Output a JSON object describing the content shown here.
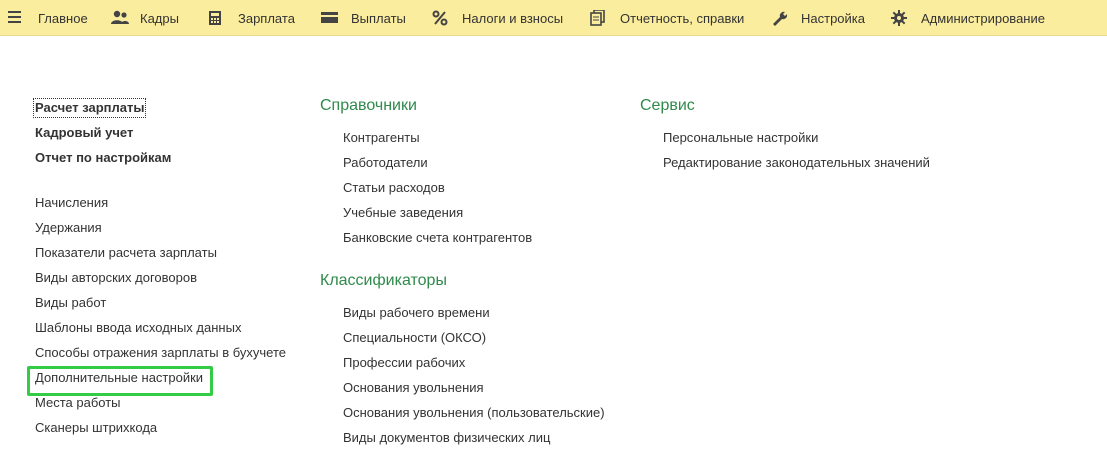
{
  "menu": {
    "items": [
      {
        "icon": "hamburger-icon",
        "label": "Главное"
      },
      {
        "icon": "people-icon",
        "label": "Кадры"
      },
      {
        "icon": "calculator-icon",
        "label": "Зарплата"
      },
      {
        "icon": "payments-card-icon",
        "label": "Выплаты"
      },
      {
        "icon": "percent-icon",
        "label": "Налоги и взносы"
      },
      {
        "icon": "reports-icon",
        "label": "Отчетность, справки"
      },
      {
        "icon": "wrench-icon",
        "label": "Настройка"
      },
      {
        "icon": "gear-icon",
        "label": "Администрирование"
      }
    ]
  },
  "left": {
    "main_links": [
      "Расчет зарплаты",
      "Кадровый учет",
      "Отчет по настройкам"
    ],
    "links": [
      "Начисления",
      "Удержания",
      "Показатели расчета зарплаты",
      "Виды авторских договоров",
      "Виды работ",
      "Шаблоны ввода исходных данных",
      "Способы отражения зарплаты в бухучете",
      "Дополнительные настройки",
      "Места работы",
      "Сканеры штрихкода"
    ]
  },
  "middle": {
    "sections": [
      {
        "title": "Справочники",
        "links": [
          "Контрагенты",
          "Работодатели",
          "Статьи расходов",
          "Учебные заведения",
          "Банковские счета контрагентов"
        ]
      },
      {
        "title": "Классификаторы",
        "links": [
          "Виды рабочего времени",
          "Специальности (ОКСО)",
          "Профессии рабочих",
          "Основания увольнения",
          "Основания увольнения (пользовательские)",
          "Виды документов физических лиц"
        ]
      }
    ]
  },
  "right": {
    "sections": [
      {
        "title": "Сервис",
        "links": [
          "Персональные настройки",
          "Редактирование законодательных значений"
        ]
      }
    ]
  },
  "colors": {
    "topbar_bg": "#fbed9e",
    "group_title": "#2f8a4b",
    "highlight": "#33cc44"
  }
}
